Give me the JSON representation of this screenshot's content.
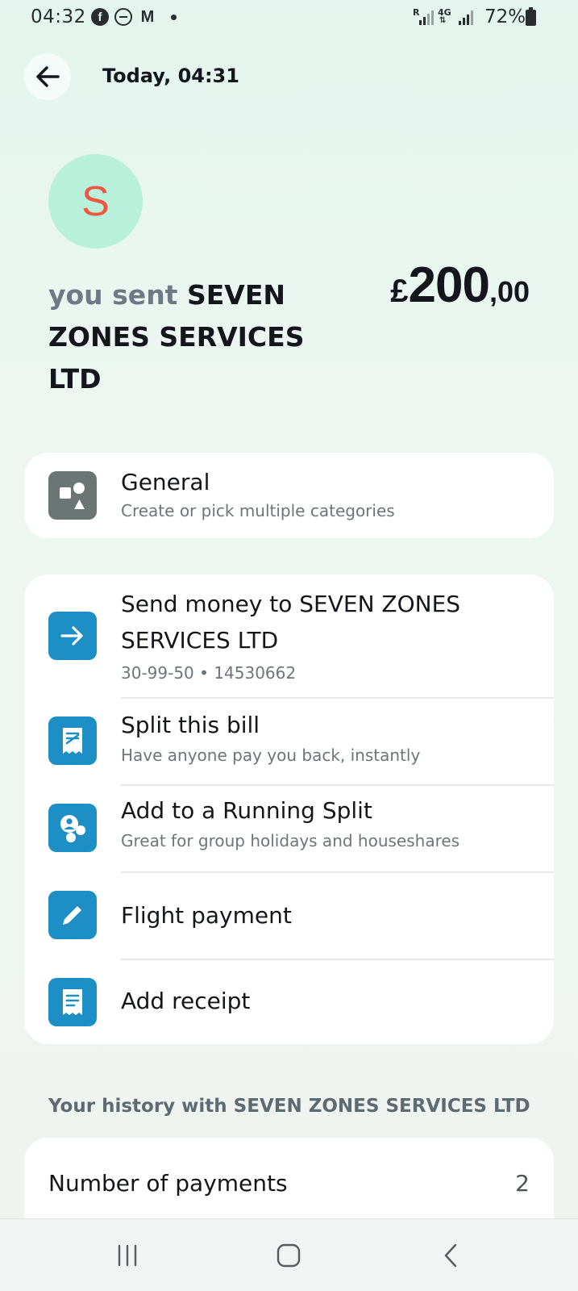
{
  "status_bar": {
    "time": "04:32",
    "signal_label_1": "R",
    "signal_label_2": "4G",
    "battery": "72%"
  },
  "header": {
    "title": "Today, 04:31"
  },
  "merchant": {
    "initial": "S",
    "sent_prefix": "you sent",
    "name": "SEVEN ZONES SERVICES LTD",
    "amount_currency": "£",
    "amount_main": "200",
    "amount_decimal": ",00"
  },
  "category": {
    "title": "General",
    "subtitle": "Create or pick multiple categories",
    "icon": "shapes-icon"
  },
  "actions": [
    {
      "title": "Send money to SEVEN ZONES SERVICES LTD",
      "subtitle": "30-99-50 • 14530662",
      "icon": "arrow-right-icon"
    },
    {
      "title": "Split this bill",
      "subtitle": "Have anyone pay you back, instantly",
      "icon": "split-bill-icon"
    },
    {
      "title": "Add to a Running Split",
      "subtitle": "Great for group holidays and houseshares",
      "icon": "group-icon"
    },
    {
      "title": "Flight payment",
      "subtitle": "",
      "icon": "pencil-icon"
    },
    {
      "title": "Add receipt",
      "subtitle": "",
      "icon": "receipt-icon"
    }
  ],
  "history": {
    "title": "Your history with SEVEN ZONES SERVICES LTD",
    "rows": [
      {
        "label": "Number of payments",
        "value": "2"
      }
    ]
  },
  "colors": {
    "accent_blue": "#1d8fc4",
    "avatar_bg": "#b8f0dc",
    "avatar_letter": "#f0553f",
    "background": "#e3f5ee"
  }
}
